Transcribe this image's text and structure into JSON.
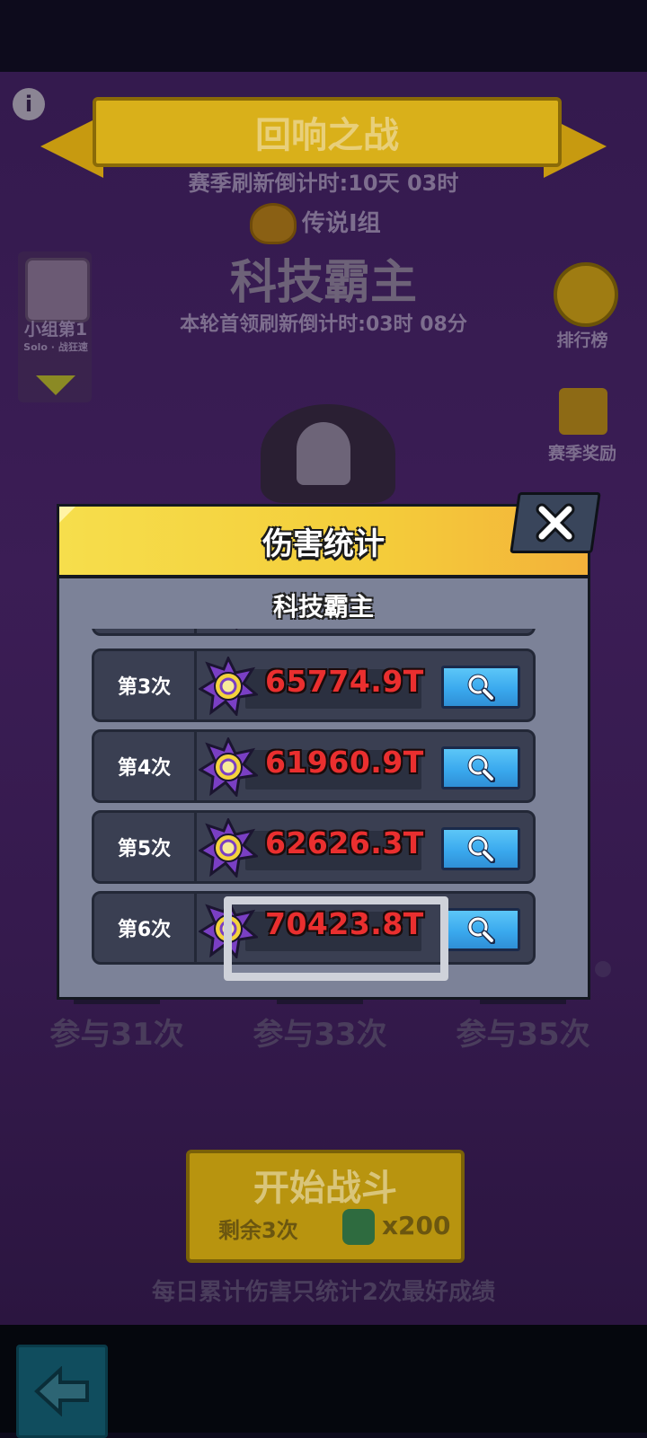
{
  "background": {
    "event_title": "回响之战",
    "season_countdown": "赛季刷新倒计时:10天 03时",
    "group_label": "传说I组",
    "boss_name": "科技霸主",
    "first_kill_countdown": "本轮首领刷新倒计时:03时 08分",
    "left_panel": {
      "rank_text": "小组第1",
      "sub_text": "Solo · 战狂速"
    },
    "right_menu": [
      {
        "label": "排行榜",
        "icon": "coin-icon"
      },
      {
        "label": "赛季奖励",
        "icon": "gift-icon"
      }
    ],
    "milestones": [
      "参与31次",
      "参与33次",
      "参与35次"
    ],
    "start_button": {
      "label": "开始战斗",
      "remaining": "剩余3次",
      "cost": "x200",
      "cost_icon": "gem-icon"
    },
    "footer_note": "每日累计伤害只统计2次最好成绩"
  },
  "modal": {
    "title": "伤害统计",
    "subtitle": "科技霸主",
    "close_icon": "close-icon",
    "rows": [
      {
        "label": "第3次",
        "value": "65774.9T"
      },
      {
        "label": "第4次",
        "value": "61960.9T"
      },
      {
        "label": "第5次",
        "value": "62626.3T"
      },
      {
        "label": "第6次",
        "value": "70423.8T"
      }
    ],
    "highlighted_row": "第6次"
  },
  "colors": {
    "header_yellow": "#f6de4c",
    "header_orange": "#f3b23a",
    "damage_red": "#ea2f2f",
    "search_blue": "#3aa9ee",
    "panel_dark": "#3a3f52",
    "panel_light": "#7c8298"
  }
}
